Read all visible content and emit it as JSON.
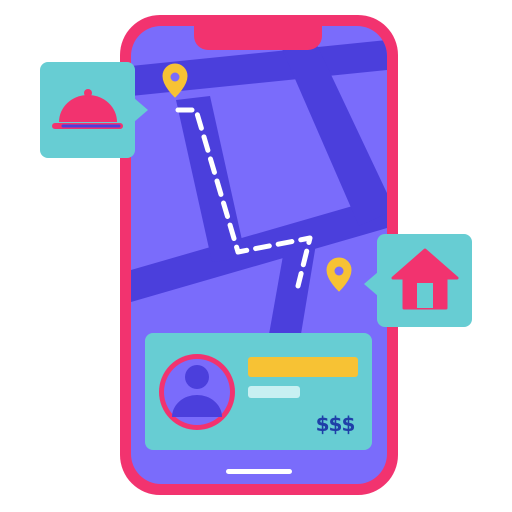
{
  "courier_card": {
    "price": "$$$"
  },
  "colors": {
    "phone_frame": "#f2336f",
    "map_background": "#7a6cfb",
    "roads": "#4b3fdc",
    "route_dashes": "#ffffff",
    "location_pin": "#f7c234",
    "bubble_background": "#67cdd3",
    "food_cloche": "#f2336f",
    "home_icon": "#f2336f",
    "avatar_ring": "#f2336f",
    "avatar_person": "#4b3fdc",
    "name_bar": "#f7c234",
    "detail_bar": "#c8f0f2",
    "price_text": "#1f3fa8"
  },
  "icons": {
    "restaurant": "food-cloche-icon",
    "destination": "home-icon",
    "pins": "map-pin-icon",
    "courier": "user-avatar-icon"
  }
}
